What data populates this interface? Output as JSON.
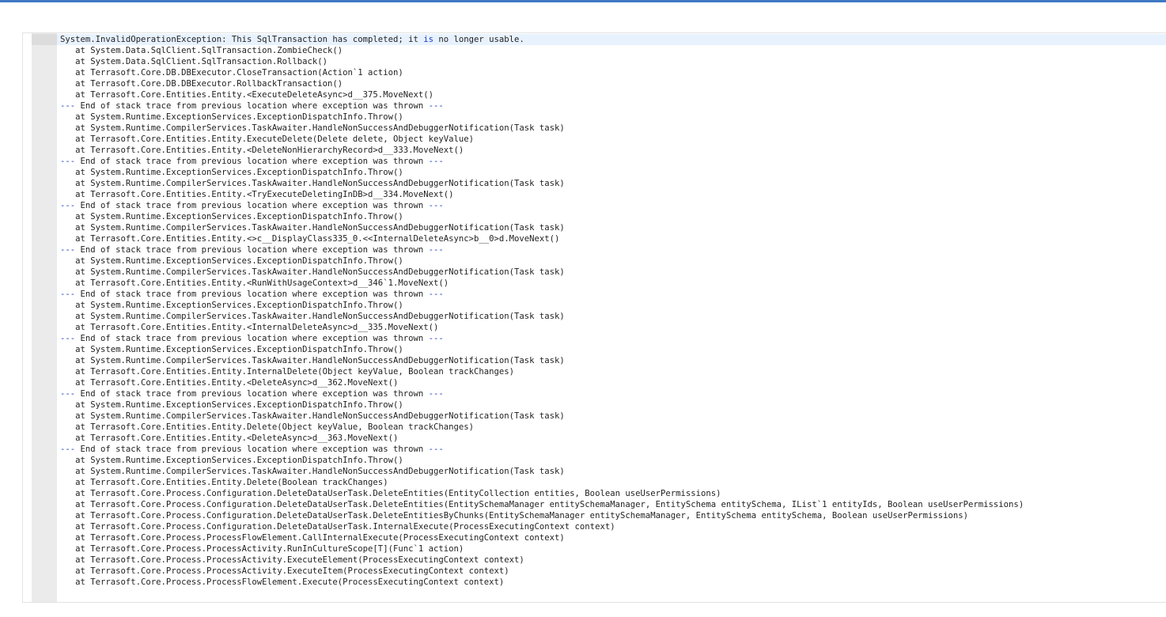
{
  "editor": {
    "line0": {
      "a": "System.InvalidOperationException: This SqlTransaction has completed; it ",
      "kw": "is",
      "b": " no longer usable."
    },
    "sep_prefix": "--- ",
    "sep_text": "End of stack trace from previous location where exception was thrown",
    "sep_suffix": " ---",
    "lines": [
      "   at System.Data.SqlClient.SqlTransaction.ZombieCheck()",
      "   at System.Data.SqlClient.SqlTransaction.Rollback()",
      "   at Terrasoft.Core.DB.DBExecutor.CloseTransaction(Action`1 action)",
      "   at Terrasoft.Core.DB.DBExecutor.RollbackTransaction()",
      "   at Terrasoft.Core.Entities.Entity.<ExecuteDeleteAsync>d__375.MoveNext()",
      "SEP",
      "   at System.Runtime.ExceptionServices.ExceptionDispatchInfo.Throw()",
      "   at System.Runtime.CompilerServices.TaskAwaiter.HandleNonSuccessAndDebuggerNotification(Task task)",
      "   at Terrasoft.Core.Entities.Entity.ExecuteDelete(Delete delete, Object keyValue)",
      "   at Terrasoft.Core.Entities.Entity.<DeleteNonHierarchyRecord>d__333.MoveNext()",
      "SEP",
      "   at System.Runtime.ExceptionServices.ExceptionDispatchInfo.Throw()",
      "   at System.Runtime.CompilerServices.TaskAwaiter.HandleNonSuccessAndDebuggerNotification(Task task)",
      "   at Terrasoft.Core.Entities.Entity.<TryExecuteDeletingInDB>d__334.MoveNext()",
      "SEP",
      "   at System.Runtime.ExceptionServices.ExceptionDispatchInfo.Throw()",
      "   at System.Runtime.CompilerServices.TaskAwaiter.HandleNonSuccessAndDebuggerNotification(Task task)",
      "   at Terrasoft.Core.Entities.Entity.<>c__DisplayClass335_0.<<InternalDeleteAsync>b__0>d.MoveNext()",
      "SEP",
      "   at System.Runtime.ExceptionServices.ExceptionDispatchInfo.Throw()",
      "   at System.Runtime.CompilerServices.TaskAwaiter.HandleNonSuccessAndDebuggerNotification(Task task)",
      "   at Terrasoft.Core.Entities.Entity.<RunWithUsageContext>d__346`1.MoveNext()",
      "SEP",
      "   at System.Runtime.ExceptionServices.ExceptionDispatchInfo.Throw()",
      "   at System.Runtime.CompilerServices.TaskAwaiter.HandleNonSuccessAndDebuggerNotification(Task task)",
      "   at Terrasoft.Core.Entities.Entity.<InternalDeleteAsync>d__335.MoveNext()",
      "SEP",
      "   at System.Runtime.ExceptionServices.ExceptionDispatchInfo.Throw()",
      "   at System.Runtime.CompilerServices.TaskAwaiter.HandleNonSuccessAndDebuggerNotification(Task task)",
      "   at Terrasoft.Core.Entities.Entity.InternalDelete(Object keyValue, Boolean trackChanges)",
      "   at Terrasoft.Core.Entities.Entity.<DeleteAsync>d__362.MoveNext()",
      "SEP",
      "   at System.Runtime.ExceptionServices.ExceptionDispatchInfo.Throw()",
      "   at System.Runtime.CompilerServices.TaskAwaiter.HandleNonSuccessAndDebuggerNotification(Task task)",
      "   at Terrasoft.Core.Entities.Entity.Delete(Object keyValue, Boolean trackChanges)",
      "   at Terrasoft.Core.Entities.Entity.<DeleteAsync>d__363.MoveNext()",
      "SEP",
      "   at System.Runtime.ExceptionServices.ExceptionDispatchInfo.Throw()",
      "   at System.Runtime.CompilerServices.TaskAwaiter.HandleNonSuccessAndDebuggerNotification(Task task)",
      "   at Terrasoft.Core.Entities.Entity.Delete(Boolean trackChanges)",
      "   at Terrasoft.Core.Process.Configuration.DeleteDataUserTask.DeleteEntities(EntityCollection entities, Boolean useUserPermissions)",
      "   at Terrasoft.Core.Process.Configuration.DeleteDataUserTask.DeleteEntities(EntitySchemaManager entitySchemaManager, EntitySchema entitySchema, IList`1 entityIds, Boolean useUserPermissions)",
      "   at Terrasoft.Core.Process.Configuration.DeleteDataUserTask.DeleteEntitiesByChunks(EntitySchemaManager entitySchemaManager, EntitySchema entitySchema, Boolean useUserPermissions)",
      "   at Terrasoft.Core.Process.Configuration.DeleteDataUserTask.InternalExecute(ProcessExecutingContext context)",
      "   at Terrasoft.Core.Process.ProcessFlowElement.CallInternalExecute(ProcessExecutingContext context)",
      "   at Terrasoft.Core.Process.ProcessActivity.RunInCultureScope[T](Func`1 action)",
      "   at Terrasoft.Core.Process.ProcessActivity.ExecuteElement(ProcessExecutingContext context)",
      "   at Terrasoft.Core.Process.ProcessActivity.ExecuteItem(ProcessExecutingContext context)",
      "   at Terrasoft.Core.Process.ProcessFlowElement.Execute(ProcessExecutingContext context)"
    ]
  }
}
